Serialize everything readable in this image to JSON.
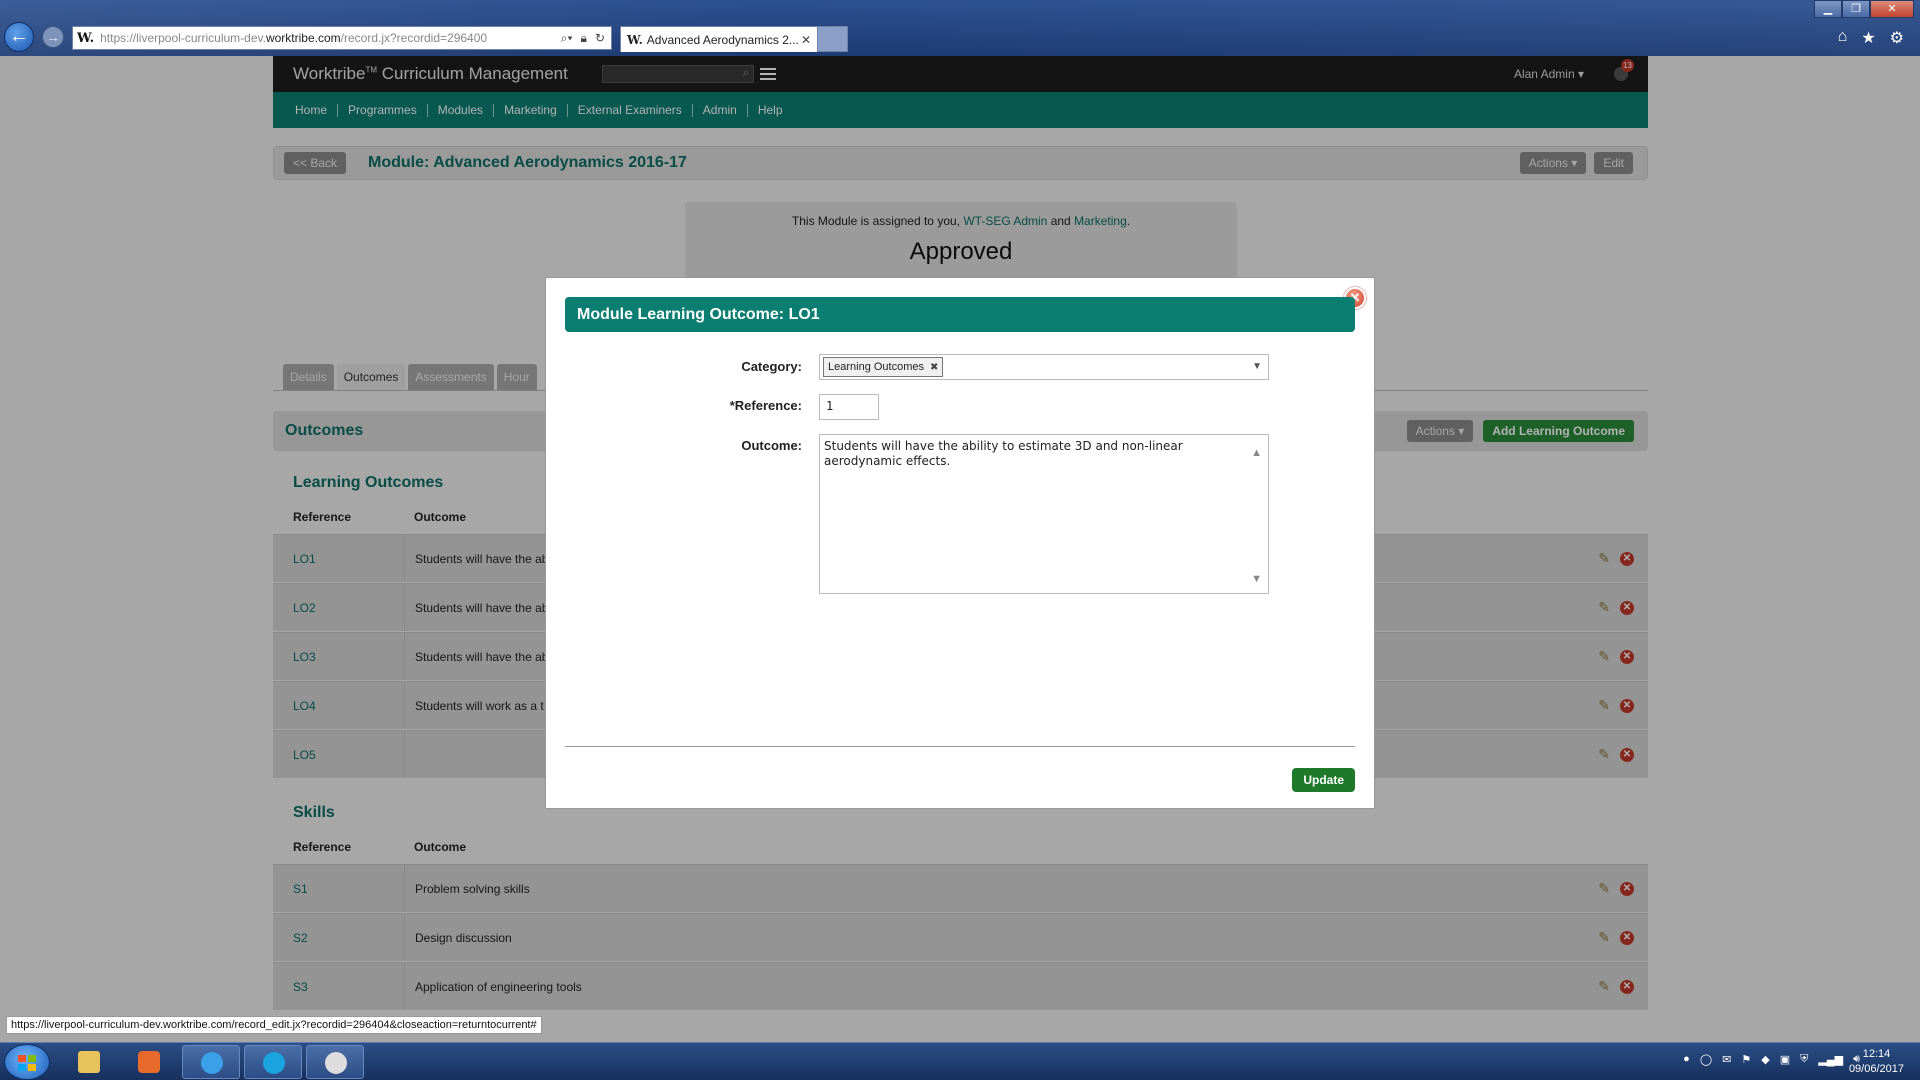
{
  "browser": {
    "url_prefix": "https://liverpool-curriculum-dev.",
    "url_domain": "worktribe.com",
    "url_path": "/record.jx?recordid=296400",
    "favicon": "W.",
    "tab_title": "Advanced Aerodynamics 2...",
    "status_url": "https://liverpool-curriculum-dev.worktribe.com/record_edit.jx?recordid=296404&closeaction=returntocurrent#"
  },
  "app": {
    "brand": "Worktribe",
    "brand_tm": "TM",
    "brand_suffix": " Curriculum Management",
    "user": "Alan Admin ▾",
    "notifications": "13",
    "nav": [
      "Home",
      "Programmes",
      "Modules",
      "Marketing",
      "External Examiners",
      "Admin",
      "Help"
    ]
  },
  "titlebar": {
    "back": "<< Back",
    "title": "Module: Advanced Aerodynamics 2016-17",
    "actions": "Actions ▾",
    "edit": "Edit"
  },
  "assignment": {
    "prefix": "This Module is assigned to you, ",
    "link1": "WT-SEG Admin",
    "mid": " and ",
    "link2": "Marketing",
    "suffix": ".",
    "state": "Approved"
  },
  "tabs": [
    "Details",
    "Outcomes",
    "Assessments",
    "Hour"
  ],
  "outcomes": {
    "heading": "Outcomes",
    "actions": "Actions ▾",
    "add": "Add Learning Outcome"
  },
  "learning_outcomes": {
    "heading": "Learning Outcomes",
    "col_ref": "Reference",
    "col_out": "Outcome",
    "rows": [
      {
        "ref": "LO1",
        "out": "Students will have the ab"
      },
      {
        "ref": "LO2",
        "out": "Students will have the ab"
      },
      {
        "ref": "LO3",
        "out": "Students will have the ab"
      },
      {
        "ref": "LO4",
        "out": "Students will work as a t"
      },
      {
        "ref": "LO5",
        "out": ""
      }
    ]
  },
  "skills": {
    "heading": "Skills",
    "col_ref": "Reference",
    "col_out": "Outcome",
    "rows": [
      {
        "ref": "S1",
        "out": "Problem solving skills"
      },
      {
        "ref": "S2",
        "out": "Design discussion"
      },
      {
        "ref": "S3",
        "out": "Application of engineering tools"
      }
    ]
  },
  "modal": {
    "title": "Module Learning Outcome: LO1",
    "category_label": "Category:",
    "category_value": "Learning Outcomes",
    "reference_label": "*Reference:",
    "reference_value": "1",
    "outcome_label": "Outcome:",
    "outcome_value": "Students will have the ability to estimate 3D and non-linear aerodynamic effects.",
    "update": "Update"
  },
  "clock": {
    "time": "12:14",
    "date": "09/06/2017"
  }
}
